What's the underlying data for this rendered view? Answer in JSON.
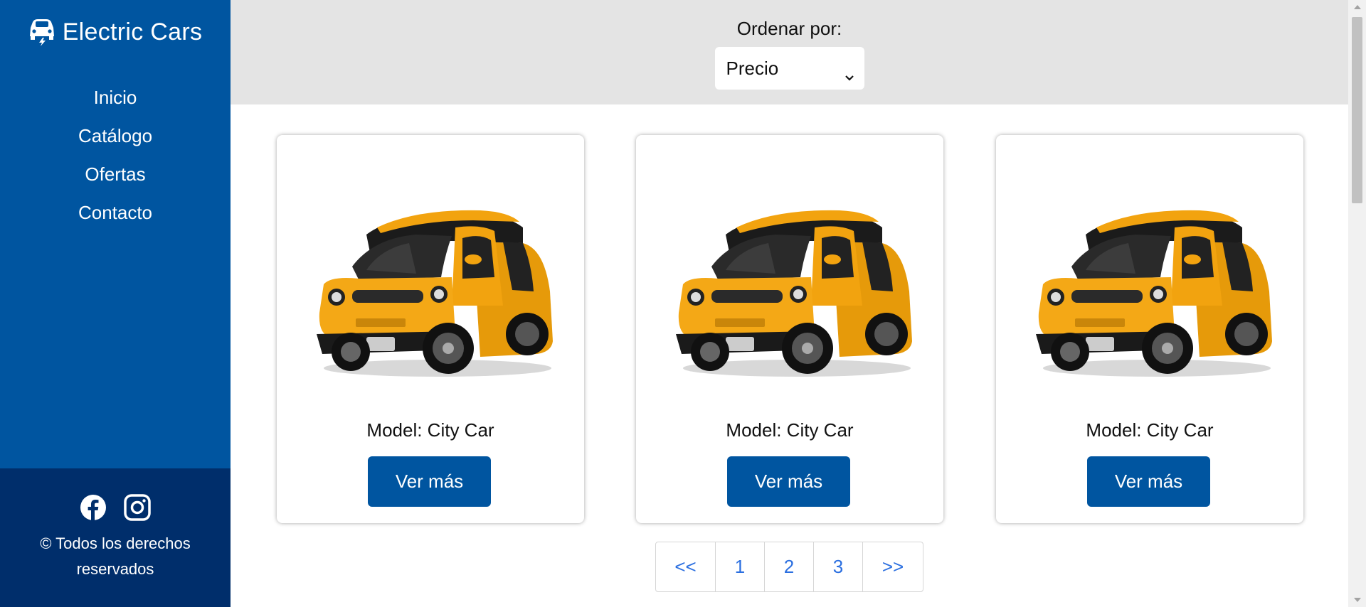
{
  "brand": {
    "name": "Electric Cars",
    "icon": "car-charging-icon"
  },
  "nav": [
    {
      "label": "Inicio"
    },
    {
      "label": "Catálogo"
    },
    {
      "label": "Ofertas"
    },
    {
      "label": "Contacto"
    }
  ],
  "footer": {
    "social": [
      {
        "icon": "facebook-icon"
      },
      {
        "icon": "instagram-icon"
      }
    ],
    "copyright": "© Todos los derechos reservados"
  },
  "sort": {
    "label": "Ordenar por:",
    "selected": "Precio"
  },
  "cards": [
    {
      "model": "Model: City Car",
      "button": "Ver más",
      "image": "yellow-city-car"
    },
    {
      "model": "Model: City Car",
      "button": "Ver más",
      "image": "yellow-city-car"
    },
    {
      "model": "Model: City Car",
      "button": "Ver más",
      "image": "yellow-city-car"
    }
  ],
  "pagination": {
    "prev": "<<",
    "pages": [
      "1",
      "2",
      "3"
    ],
    "next": ">>"
  },
  "colors": {
    "sidebar": "#0055a0",
    "sidebar_footer": "#002e6b",
    "button": "#0055a0",
    "sort_bar": "#e4e4e4",
    "link": "#2b6fe0",
    "car_body": "#f2a30f"
  }
}
